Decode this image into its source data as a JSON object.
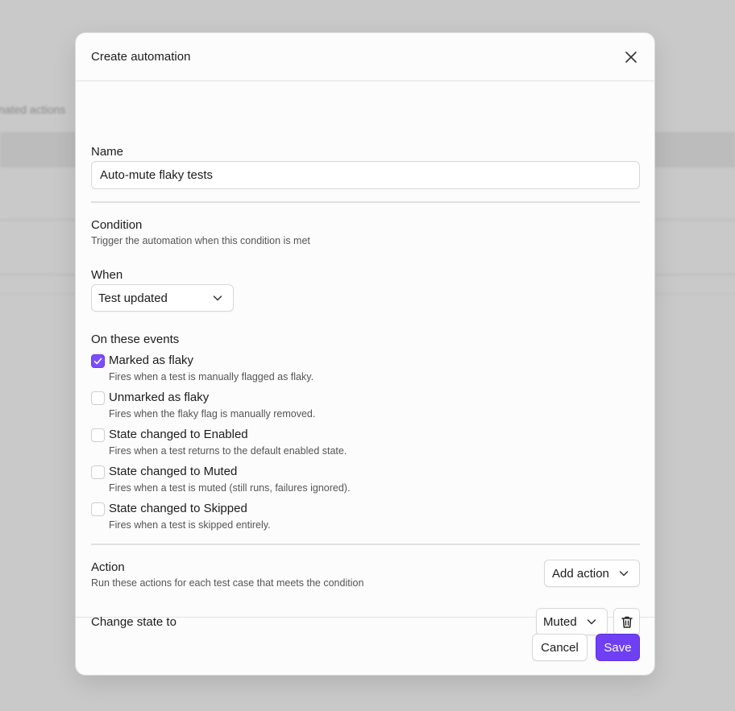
{
  "background": {
    "partial_text": "nated actions"
  },
  "modal": {
    "title": "Create automation",
    "name": {
      "label": "Name",
      "value": "Auto-mute flaky tests"
    },
    "condition": {
      "title": "Condition",
      "description": "Trigger the automation when this condition is met",
      "when_label": "When",
      "when_value": "Test updated",
      "events_label": "On these events",
      "events": [
        {
          "title": "Marked as flaky",
          "description": "Fires when a test is manually flagged as flaky.",
          "checked": true
        },
        {
          "title": "Unmarked as flaky",
          "description": "Fires when the flaky flag is manually removed.",
          "checked": false
        },
        {
          "title": "State changed to Enabled",
          "description": "Fires when a test returns to the default enabled state.",
          "checked": false
        },
        {
          "title": "State changed to Muted",
          "description": "Fires when a test is muted (still runs, failures ignored).",
          "checked": false
        },
        {
          "title": "State changed to Skipped",
          "description": "Fires when a test is skipped entirely.",
          "checked": false
        }
      ]
    },
    "action": {
      "title": "Action",
      "description": "Run these actions for each test case that meets the condition",
      "add_action_label": "Add action",
      "change_state_label": "Change state to",
      "state_value": "Muted"
    },
    "footer": {
      "cancel_label": "Cancel",
      "save_label": "Save"
    }
  },
  "colors": {
    "accent": "#6e3ff3",
    "checkbox_checked": "#7c4dff",
    "overlay": "#c9c9c9"
  },
  "icons": {
    "close": "close-icon",
    "chevron": "chevron-down-icon",
    "delete": "trash-icon",
    "check": "checkmark-icon"
  }
}
